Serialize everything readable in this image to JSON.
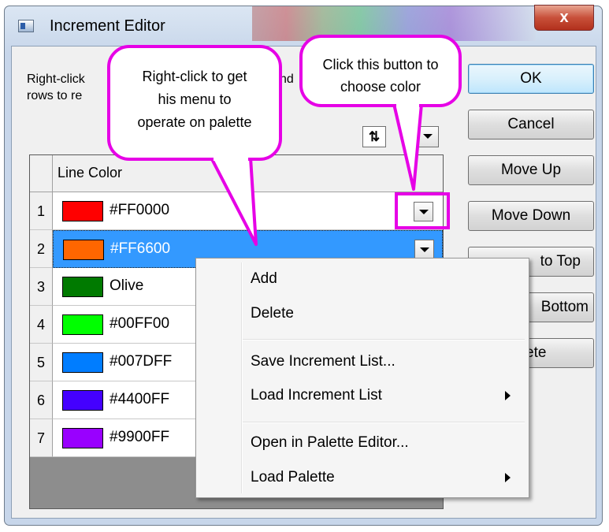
{
  "window": {
    "title": "Increment Editor",
    "close_glyph": "x"
  },
  "instructions": {
    "line1": "Right-click",
    "line1_tail": "nd",
    "line2": "rows to  re"
  },
  "buttons": {
    "ok": "OK",
    "cancel": "Cancel",
    "move_up": "Move Up",
    "move_down": "Move Down",
    "move_to_top": "to Top",
    "move_to_bottom": "Bottom",
    "delete": "ete"
  },
  "toolbar": {
    "sort_glyph": "⇅"
  },
  "grid": {
    "header": "Line Color",
    "rows": [
      {
        "num": "1",
        "color": "#FF0000",
        "label": "#FF0000"
      },
      {
        "num": "2",
        "color": "#FF6600",
        "label": "#FF6600"
      },
      {
        "num": "3",
        "color": "#007A00",
        "label": "Olive"
      },
      {
        "num": "4",
        "color": "#00FF00",
        "label": "#00FF00"
      },
      {
        "num": "5",
        "color": "#007DFF",
        "label": "#007DFF"
      },
      {
        "num": "6",
        "color": "#4400FF",
        "label": "#4400FF"
      },
      {
        "num": "7",
        "color": "#9900FF",
        "label": "#9900FF"
      }
    ]
  },
  "context_menu": {
    "items": [
      "Add",
      "Delete",
      "Save Increment List...",
      "Load Increment List",
      "Open in Palette Editor...",
      "Load Palette"
    ]
  },
  "callouts": {
    "left": [
      "Right-click to get",
      "his menu to",
      "operate on palette"
    ],
    "right": [
      "Click this button to",
      "choose color"
    ]
  },
  "colors": {
    "highlight": "#E600E6",
    "selection": "#3399FF"
  }
}
